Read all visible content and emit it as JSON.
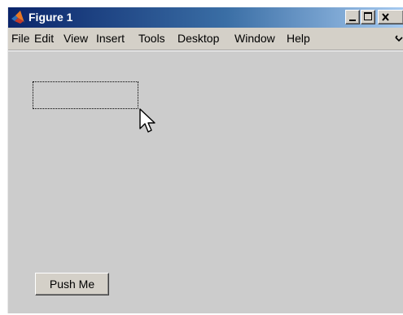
{
  "window": {
    "title": "Figure 1"
  },
  "menu": {
    "items": [
      "File",
      "Edit",
      "View",
      "Insert",
      "Tools",
      "Desktop",
      "Window",
      "Help"
    ],
    "overflow_icon": "chevron-overflow-icon"
  },
  "figure": {
    "push_button_label": "Push Me"
  },
  "colors": {
    "title_bar_start": "#0a246a",
    "title_bar_end": "#a6caf0",
    "figure_background": "#cccccc",
    "chrome": "#d4d0c8"
  }
}
